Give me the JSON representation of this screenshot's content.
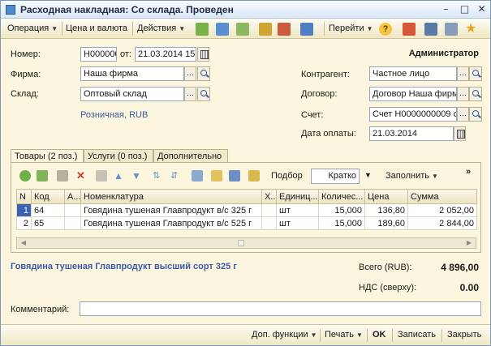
{
  "window": {
    "title": "Расходная накладная: Со склада. Проведен"
  },
  "toolbar": {
    "operation": "Операция",
    "price_currency": "Цена и валюта",
    "actions": "Действия",
    "goto": "Перейти",
    "help_glyph": "?"
  },
  "header": {
    "number_label": "Номер:",
    "number_value": "Н000000009",
    "from_label": "от:",
    "date_value": "21.03.2014 15:",
    "user": "Администратор",
    "firm_label": "Фирма:",
    "firm_value": "Наша фирма",
    "warehouse_label": "Склад:",
    "warehouse_value": "Оптовый склад",
    "price_type": "Розничная, RUB",
    "counterparty_label": "Контрагент:",
    "counterparty_value": "Частное лицо",
    "contract_label": "Договор:",
    "contract_value": "Договор Наша фирма",
    "invoice_label": "Счет:",
    "invoice_value": "Счет Н0000000009 от",
    "paydate_label": "Дата оплаты:",
    "paydate_value": "21.03.2014"
  },
  "tabs": [
    {
      "label": "Товары (2 поз.)"
    },
    {
      "label": "Услуги (0 поз.)"
    },
    {
      "label": "Дополнительно"
    }
  ],
  "panel_toolbar": {
    "podbor": "Подбор",
    "kratko": "Кратко",
    "fill": "Заполнить",
    "more": "»"
  },
  "table": {
    "columns": [
      "N",
      "Код",
      "А...",
      "Номенклатура",
      "Х...",
      "Единиц...",
      "Количес...",
      "Цена",
      "Сумма"
    ],
    "rows": [
      {
        "n": "1",
        "code": "64",
        "a": "",
        "name": "Говядина тушеная Главпродукт в/с 325 г",
        "x": "",
        "unit": "шт",
        "qty": "15,000",
        "price": "136,80",
        "sum": "2 052,00"
      },
      {
        "n": "2",
        "code": "65",
        "a": "",
        "name": "Говядина тушеная Главпродукт в/с 525 г",
        "x": "",
        "unit": "шт",
        "qty": "15,000",
        "price": "189,60",
        "sum": "2 844,00"
      }
    ]
  },
  "summary": {
    "nomenclature_full": "Говядина тушеная Главпродукт высший сорт 325 г",
    "total_label": "Всего (RUB):",
    "total_value": "4 896,00",
    "vat_label": "НДС (сверху):",
    "vat_value": "0.00"
  },
  "comment": {
    "label": "Комментарий:",
    "value": ""
  },
  "footer": {
    "extra_functions": "Доп. функции",
    "print": "Печать",
    "ok": "OK",
    "save": "Записать",
    "close": "Закрыть"
  },
  "colors": {
    "selection": "#3b63b0",
    "link": "#3b5aa8",
    "background": "#fbf6dd"
  }
}
